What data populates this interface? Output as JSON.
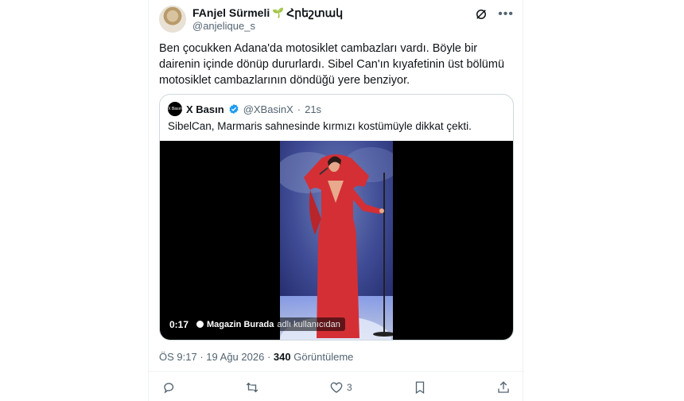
{
  "author": {
    "display_name": "FAnjel Sürmeli",
    "badge_emoji": "🌱",
    "badge_text": "Հրեշտակ",
    "handle": "@anjelique_s"
  },
  "tweet": {
    "text": "Ben çocukken Adana'da motosiklet cambazları vardı. Böyle bir dairenin içinde dönüp dururlardı. Sibel Can'ın kıyafetinin üst bölümü motosiklet cambazlarının döndüğü yere benziyor."
  },
  "quote": {
    "avatar_text": "X Basın",
    "name": "X Basın",
    "handle": "@XBasinX",
    "separator": "·",
    "time": "21s",
    "text": "SibelCan, Marmaris sahnesinde kırmızı kostümüyle dikkat çekti.",
    "video": {
      "duration": "0:17",
      "channel_name": "Magazin Burada",
      "channel_suffix": "adlı kullanıcıdan"
    }
  },
  "meta": {
    "time": "ÖS 9:17",
    "separator": "·",
    "date": "19 Ağu 2026",
    "views_count": "340",
    "views_label": "Görüntüleme"
  },
  "actions": {
    "reply_count": "",
    "retweet_count": "",
    "like_count": "3",
    "bookmark_count": "",
    "share_count": ""
  },
  "colors": {
    "text": "#0f1419",
    "secondary": "#536471",
    "border": "#cfd9de",
    "verified": "#1d9bf0",
    "dress": "#d42f35"
  },
  "icons": [
    "grok-icon",
    "more-icon",
    "verified-badge-icon",
    "reply-icon",
    "retweet-icon",
    "like-icon",
    "bookmark-icon",
    "share-icon"
  ]
}
